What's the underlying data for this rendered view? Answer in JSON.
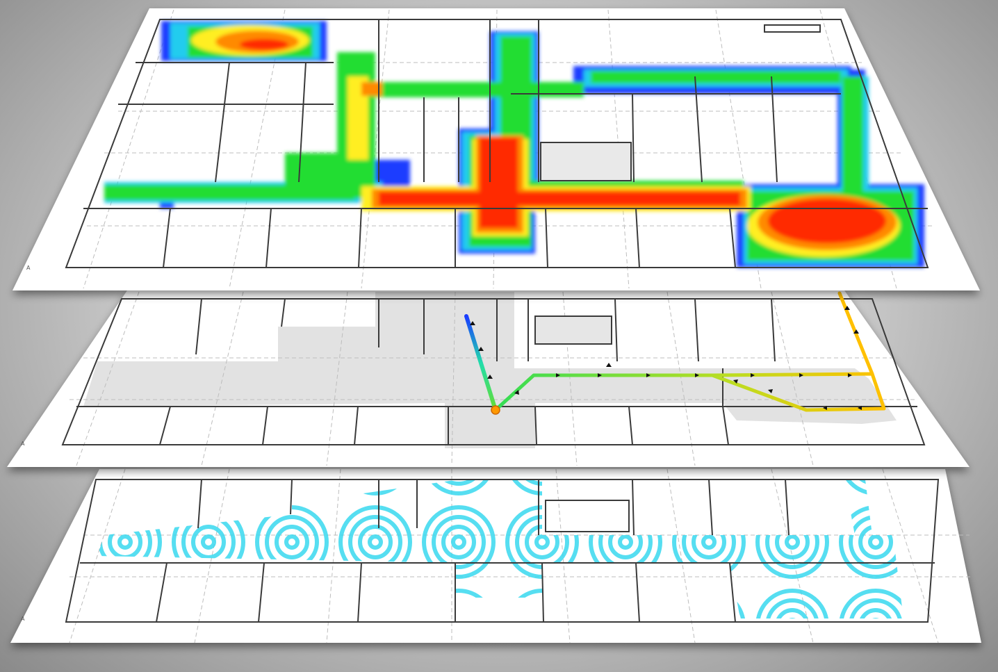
{
  "layers": [
    {
      "name": "heatmap-layer",
      "kind": "heatmap"
    },
    {
      "name": "route-layer",
      "kind": "route"
    },
    {
      "name": "coverage-layer",
      "kind": "coverage"
    }
  ],
  "axis_marks": [
    "A",
    "A",
    "A"
  ],
  "colors": {
    "paper": "#ffffff",
    "wall": "#3a3a3a",
    "grid": "#b5b5b5",
    "corridor": "#e4e4e4",
    "heat_low": "#1a3cff",
    "heat_mid": "#22dd33",
    "heat_high": "#ff2a00",
    "coverage": "#38d8ee"
  },
  "heat_zones": [
    {
      "zone": "top-left-room",
      "level": 0.82
    },
    {
      "zone": "north-corridor",
      "level": 0.45
    },
    {
      "zone": "central-vertical",
      "level": 0.55
    },
    {
      "zone": "central-stair",
      "level": 0.95
    },
    {
      "zone": "main-corridor",
      "level": 0.9
    },
    {
      "zone": "west-corridor",
      "level": 0.45
    },
    {
      "zone": "east-corridor",
      "level": 0.5
    },
    {
      "zone": "east-room",
      "level": 0.98
    }
  ],
  "route_arrow_icon": "arrowhead-icon",
  "coverage_icon": "concentric-rings-icon"
}
